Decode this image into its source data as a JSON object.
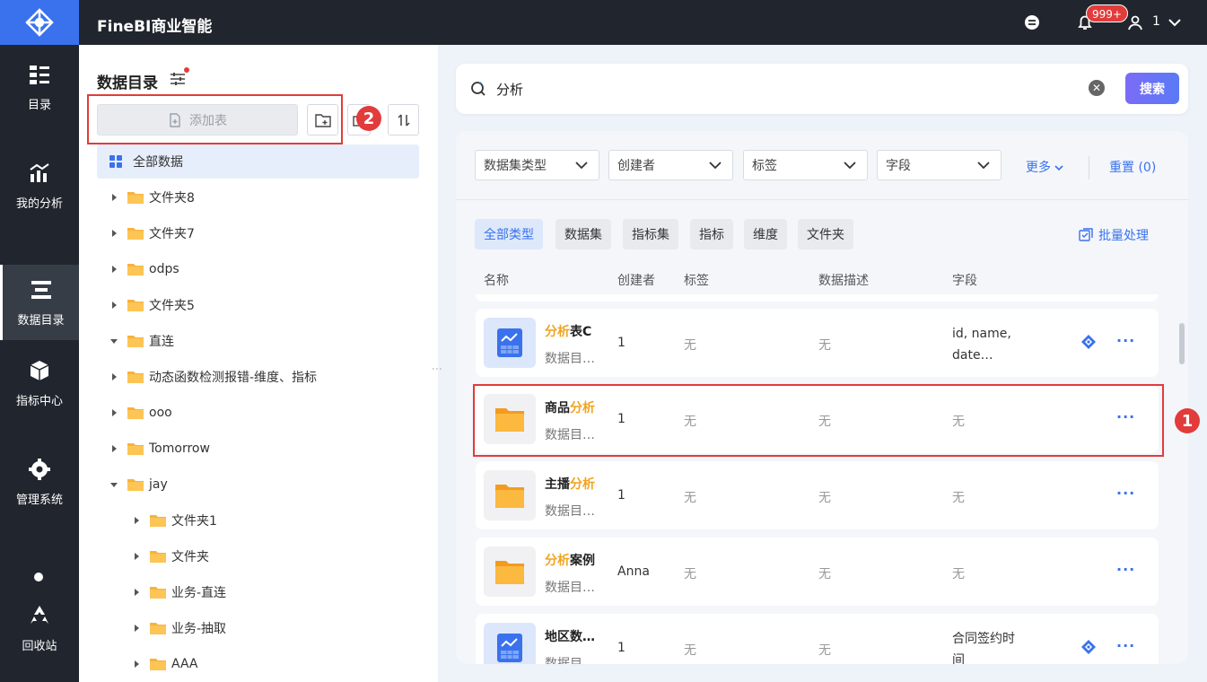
{
  "app": {
    "title": "FineBI商业智能",
    "badge": "999+",
    "user": "1"
  },
  "nav": [
    {
      "label": "目录",
      "icon": "directory-icon"
    },
    {
      "label": "我的分析",
      "icon": "analysis-icon"
    },
    {
      "label": "数据目录",
      "icon": "data-catalog-icon"
    },
    {
      "label": "指标中心",
      "icon": "metric-center-icon"
    },
    {
      "label": "管理系统",
      "icon": "settings-icon"
    },
    {
      "label": "回收站",
      "icon": "recycle-icon"
    }
  ],
  "catalog": {
    "title": "数据目录",
    "add_table": "添加表",
    "callout2": "2",
    "all_data": "全部数据",
    "tree": [
      {
        "label": "文件夹8",
        "expanded": false,
        "level": 0
      },
      {
        "label": "文件夹7",
        "expanded": false,
        "level": 0
      },
      {
        "label": "odps",
        "expanded": false,
        "level": 0
      },
      {
        "label": "文件夹5",
        "expanded": false,
        "level": 0
      },
      {
        "label": "直连",
        "expanded": true,
        "level": 0
      },
      {
        "label": "动态函数检测报错-维度、指标",
        "expanded": false,
        "level": 0
      },
      {
        "label": "ooo",
        "expanded": false,
        "level": 0
      },
      {
        "label": "Tomorrow",
        "expanded": false,
        "level": 0
      },
      {
        "label": "jay",
        "expanded": true,
        "level": 0
      },
      {
        "label": "文件夹1",
        "expanded": false,
        "level": 1
      },
      {
        "label": "文件夹",
        "expanded": false,
        "level": 1
      },
      {
        "label": "业务-直连",
        "expanded": false,
        "level": 1
      },
      {
        "label": "业务-抽取",
        "expanded": false,
        "level": 1
      },
      {
        "label": "AAA",
        "expanded": false,
        "level": 1
      }
    ]
  },
  "search": {
    "query": "分析",
    "button": "搜索"
  },
  "filters": {
    "dropdowns": [
      "数据集类型",
      "创建者",
      "标签",
      "字段"
    ],
    "more": "更多",
    "reset": "重置 (0)"
  },
  "types": {
    "chips": [
      "全部类型",
      "数据集",
      "指标集",
      "指标",
      "维度",
      "文件夹"
    ],
    "batch": "批量处理"
  },
  "columns": {
    "name": "名称",
    "creator": "创建者",
    "tag": "标签",
    "desc": "数据描述",
    "fields": "字段"
  },
  "rows": [
    {
      "name_hl": "分析",
      "name_rest": "表C",
      "hl_first": true,
      "sub": "数据目…",
      "creator": "1",
      "tag": "无",
      "desc": "无",
      "fields": "id, name, date…",
      "kind": "dataset",
      "has_action": true
    },
    {
      "name_hl": "分析",
      "name_rest": "商品",
      "hl_first": false,
      "sub": "数据目…",
      "creator": "1",
      "tag": "无",
      "desc": "无",
      "fields": "无",
      "kind": "folder",
      "has_action": false
    },
    {
      "name_hl": "分析",
      "name_rest": "主播",
      "hl_first": false,
      "sub": "数据目…",
      "creator": "1",
      "tag": "无",
      "desc": "无",
      "fields": "无",
      "kind": "folder",
      "has_action": false
    },
    {
      "name_hl": "分析",
      "name_rest": "案例",
      "hl_first": true,
      "sub": "数据目…",
      "creator": "Anna",
      "tag": "无",
      "desc": "无",
      "fields": "无",
      "kind": "folder",
      "has_action": false
    },
    {
      "name_hl": "",
      "name_rest": "地区数…",
      "hl_first": false,
      "sub": "数据目…",
      "creator": "1",
      "tag": "无",
      "desc": "无",
      "fields": "合同签约时间",
      "kind": "dataset",
      "has_action": true
    }
  ],
  "callout1": "1",
  "colors": {
    "accent": "#3a72ee",
    "highlight": "#f0a321",
    "callout": "#e23b3b",
    "topbar": "#21262e"
  }
}
